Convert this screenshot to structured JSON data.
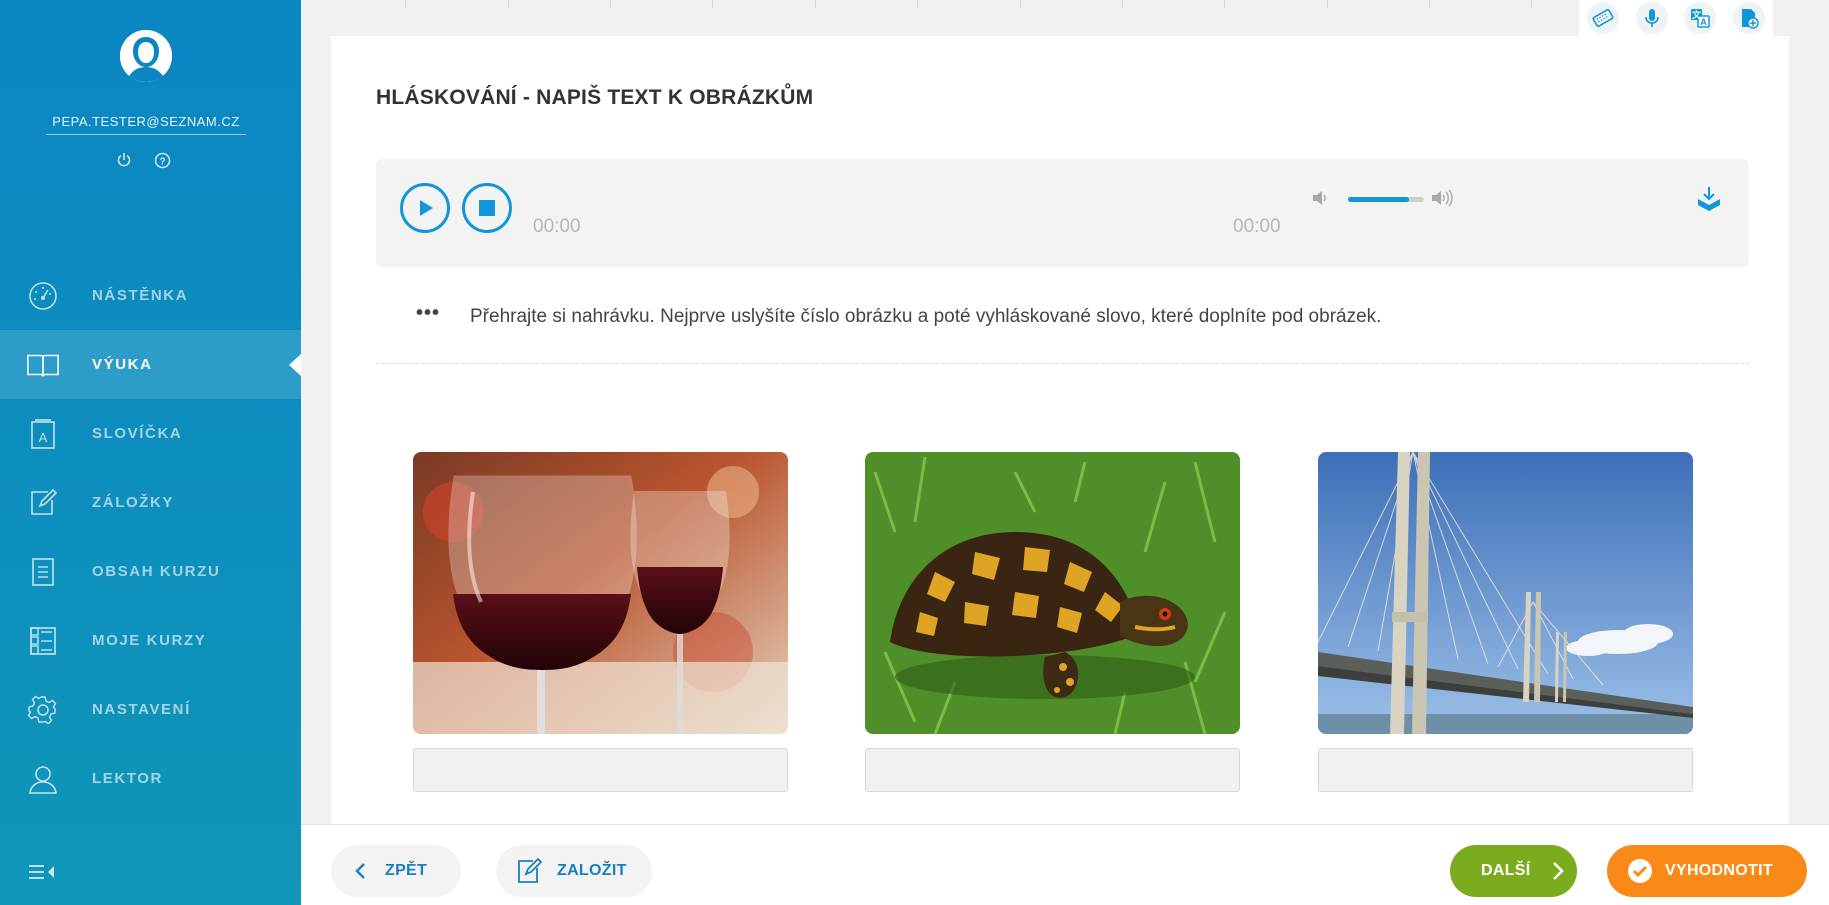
{
  "sidebar": {
    "email": "PEPA.TESTER@SEZNAM.CZ",
    "account_icons": [
      "power-icon",
      "help-icon"
    ],
    "items": [
      {
        "label": "NÁSTĚNKA",
        "icon": "dashboard-icon",
        "active": false
      },
      {
        "label": "VÝUKA",
        "icon": "book-icon",
        "active": true
      },
      {
        "label": "SLOVÍČKA",
        "icon": "vocabulary-icon",
        "active": false
      },
      {
        "label": "ZÁLOŽKY",
        "icon": "bookmark-edit-icon",
        "active": false
      },
      {
        "label": "OBSAH KURZU",
        "icon": "course-contents-icon",
        "active": false
      },
      {
        "label": "MOJE KURZY",
        "icon": "my-courses-icon",
        "active": false
      },
      {
        "label": "NASTAVENÍ",
        "icon": "settings-icon",
        "active": false
      },
      {
        "label": "LEKTOR",
        "icon": "tutor-icon",
        "active": false
      }
    ]
  },
  "tools": [
    "keyboard-icon",
    "microphone-icon",
    "translate-icon",
    "add-note-icon"
  ],
  "exercise": {
    "title": "HLÁSKOVÁNÍ - NAPIŠ TEXT K OBRÁZKŮM",
    "player": {
      "current_time": "00:00",
      "duration": "00:00",
      "volume": 0.8
    },
    "instruction": "Přehrajte si nahrávku. Nejprve uslyšíte číslo obrázku a poté vyhláskované slovo, které doplníte pod obrázek.",
    "instruction_marker": "•••",
    "pictures": [
      {
        "name": "wine-glasses-image",
        "answer": ""
      },
      {
        "name": "turtle-image",
        "answer": ""
      },
      {
        "name": "bridge-image",
        "answer": ""
      }
    ]
  },
  "footer": {
    "back_label": "ZPĚT",
    "bookmark_label": "ZALOŽIT",
    "next_label": "DALŠÍ",
    "evaluate_label": "VYHODNOTIT"
  },
  "colors": {
    "sidebar": "#0a86c2",
    "accent": "#1196d8",
    "next": "#7aac1e",
    "evaluate": "#f98a17"
  }
}
